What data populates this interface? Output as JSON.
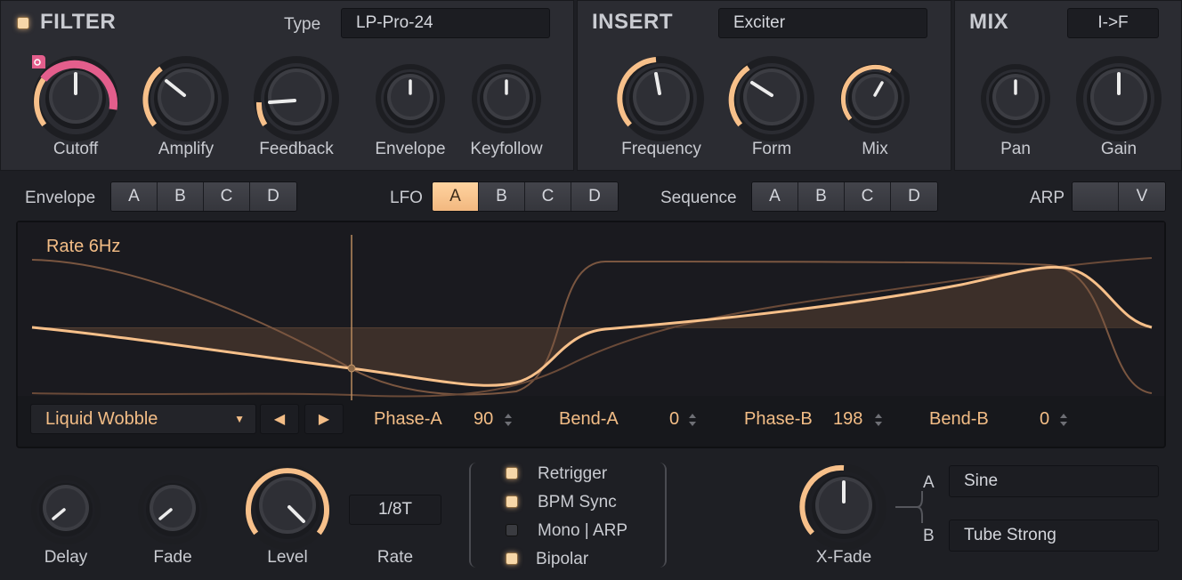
{
  "filter": {
    "title": "FILTER",
    "type_label": "Type",
    "type_value": "LP-Pro-24",
    "knobs": [
      "Cutoff",
      "Amplify",
      "Feedback",
      "Envelope",
      "Keyfollow"
    ]
  },
  "insert": {
    "title": "INSERT",
    "type_value": "Exciter",
    "knobs": [
      "Frequency",
      "Form",
      "Mix"
    ]
  },
  "mix": {
    "title": "MIX",
    "routing_value": "I->F",
    "knobs": [
      "Pan",
      "Gain"
    ]
  },
  "mod_tabs": {
    "envelope_label": "Envelope",
    "lfo_label": "LFO",
    "sequence_label": "Sequence",
    "arp_label": "ARP",
    "letters": [
      "A",
      "B",
      "C",
      "D"
    ],
    "arp_value": "V",
    "lfo_active": "A"
  },
  "lfo": {
    "rate_text": "Rate 6Hz",
    "preset": "Liquid Wobble",
    "phase_a_label": "Phase-A",
    "phase_a_value": "90",
    "bend_a_label": "Bend-A",
    "bend_a_value": "0",
    "phase_b_label": "Phase-B",
    "phase_b_value": "198",
    "bend_b_label": "Bend-B",
    "bend_b_value": "0",
    "colors": {
      "accent": "#f7c08a",
      "dim_curve": "#7a5640"
    }
  },
  "bottom": {
    "knobs": [
      "Delay",
      "Fade",
      "Level",
      "X-Fade"
    ],
    "rate_label": "Rate",
    "rate_value": "1/8T",
    "options": [
      {
        "label": "Retrigger",
        "on": true
      },
      {
        "label": "BPM Sync",
        "on": true
      },
      {
        "label": "Mono | ARP",
        "on": false
      },
      {
        "label": "Bipolar",
        "on": true
      }
    ],
    "xfade_a_label": "A",
    "xfade_a_value": "Sine",
    "xfade_b_label": "B",
    "xfade_b_value": "Tube Strong"
  }
}
